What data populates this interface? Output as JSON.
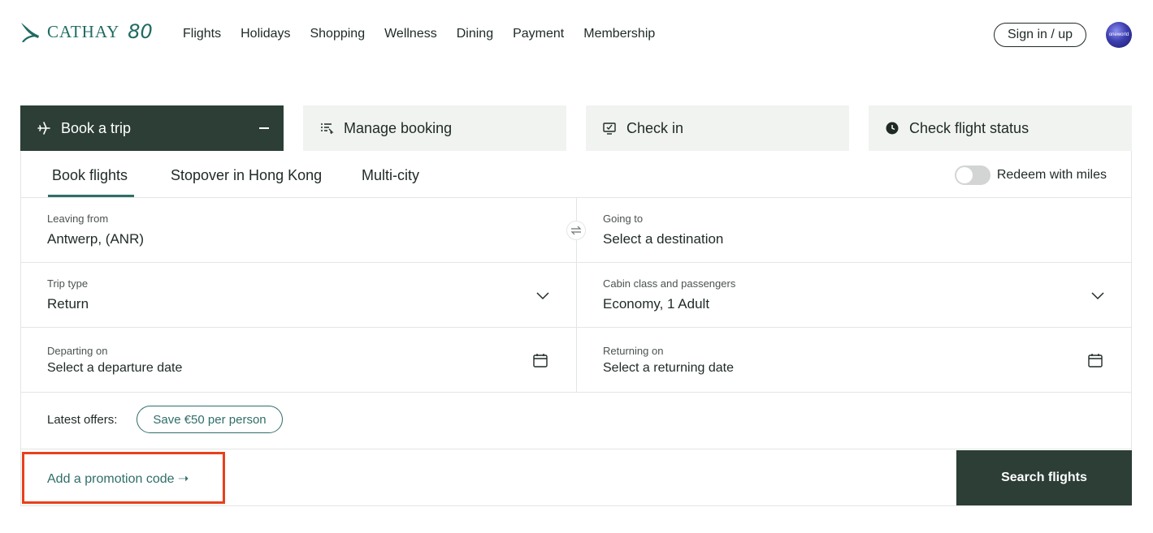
{
  "header": {
    "logo_text": "CATHAY",
    "logo_badge": "80",
    "nav": [
      "Flights",
      "Holidays",
      "Shopping",
      "Wellness",
      "Dining",
      "Payment",
      "Membership"
    ],
    "signin_label": "Sign in / up",
    "alliance_badge": "oneworld"
  },
  "main_tabs": [
    {
      "label": "Book a trip",
      "icon": "plane-icon"
    },
    {
      "label": "Manage booking",
      "icon": "list-icon"
    },
    {
      "label": "Check in",
      "icon": "check-screen-icon"
    },
    {
      "label": "Check flight status",
      "icon": "clock-icon"
    }
  ],
  "sub_tabs": [
    "Book flights",
    "Stopover in Hong Kong",
    "Multi-city"
  ],
  "redeem_label": "Redeem with miles",
  "form": {
    "leaving_from": {
      "label": "Leaving from",
      "value": "Antwerp, (ANR)"
    },
    "going_to": {
      "label": "Going to",
      "value": "Select a destination"
    },
    "trip_type": {
      "label": "Trip type",
      "value": "Return"
    },
    "cabin": {
      "label": "Cabin class and passengers",
      "value": "Economy, 1 Adult"
    },
    "departing": {
      "label": "Departing on",
      "value": "Select a departure date"
    },
    "returning": {
      "label": "Returning on",
      "value": "Select a returning date"
    }
  },
  "offers": {
    "label": "Latest offers:",
    "pill": "Save €50 per person"
  },
  "promo_link": "Add a promotion code ➝",
  "search_button": "Search flights",
  "colors": {
    "brand_dark": "#2c3e36",
    "accent_teal": "#2f6e69",
    "highlight": "#e8401c"
  }
}
